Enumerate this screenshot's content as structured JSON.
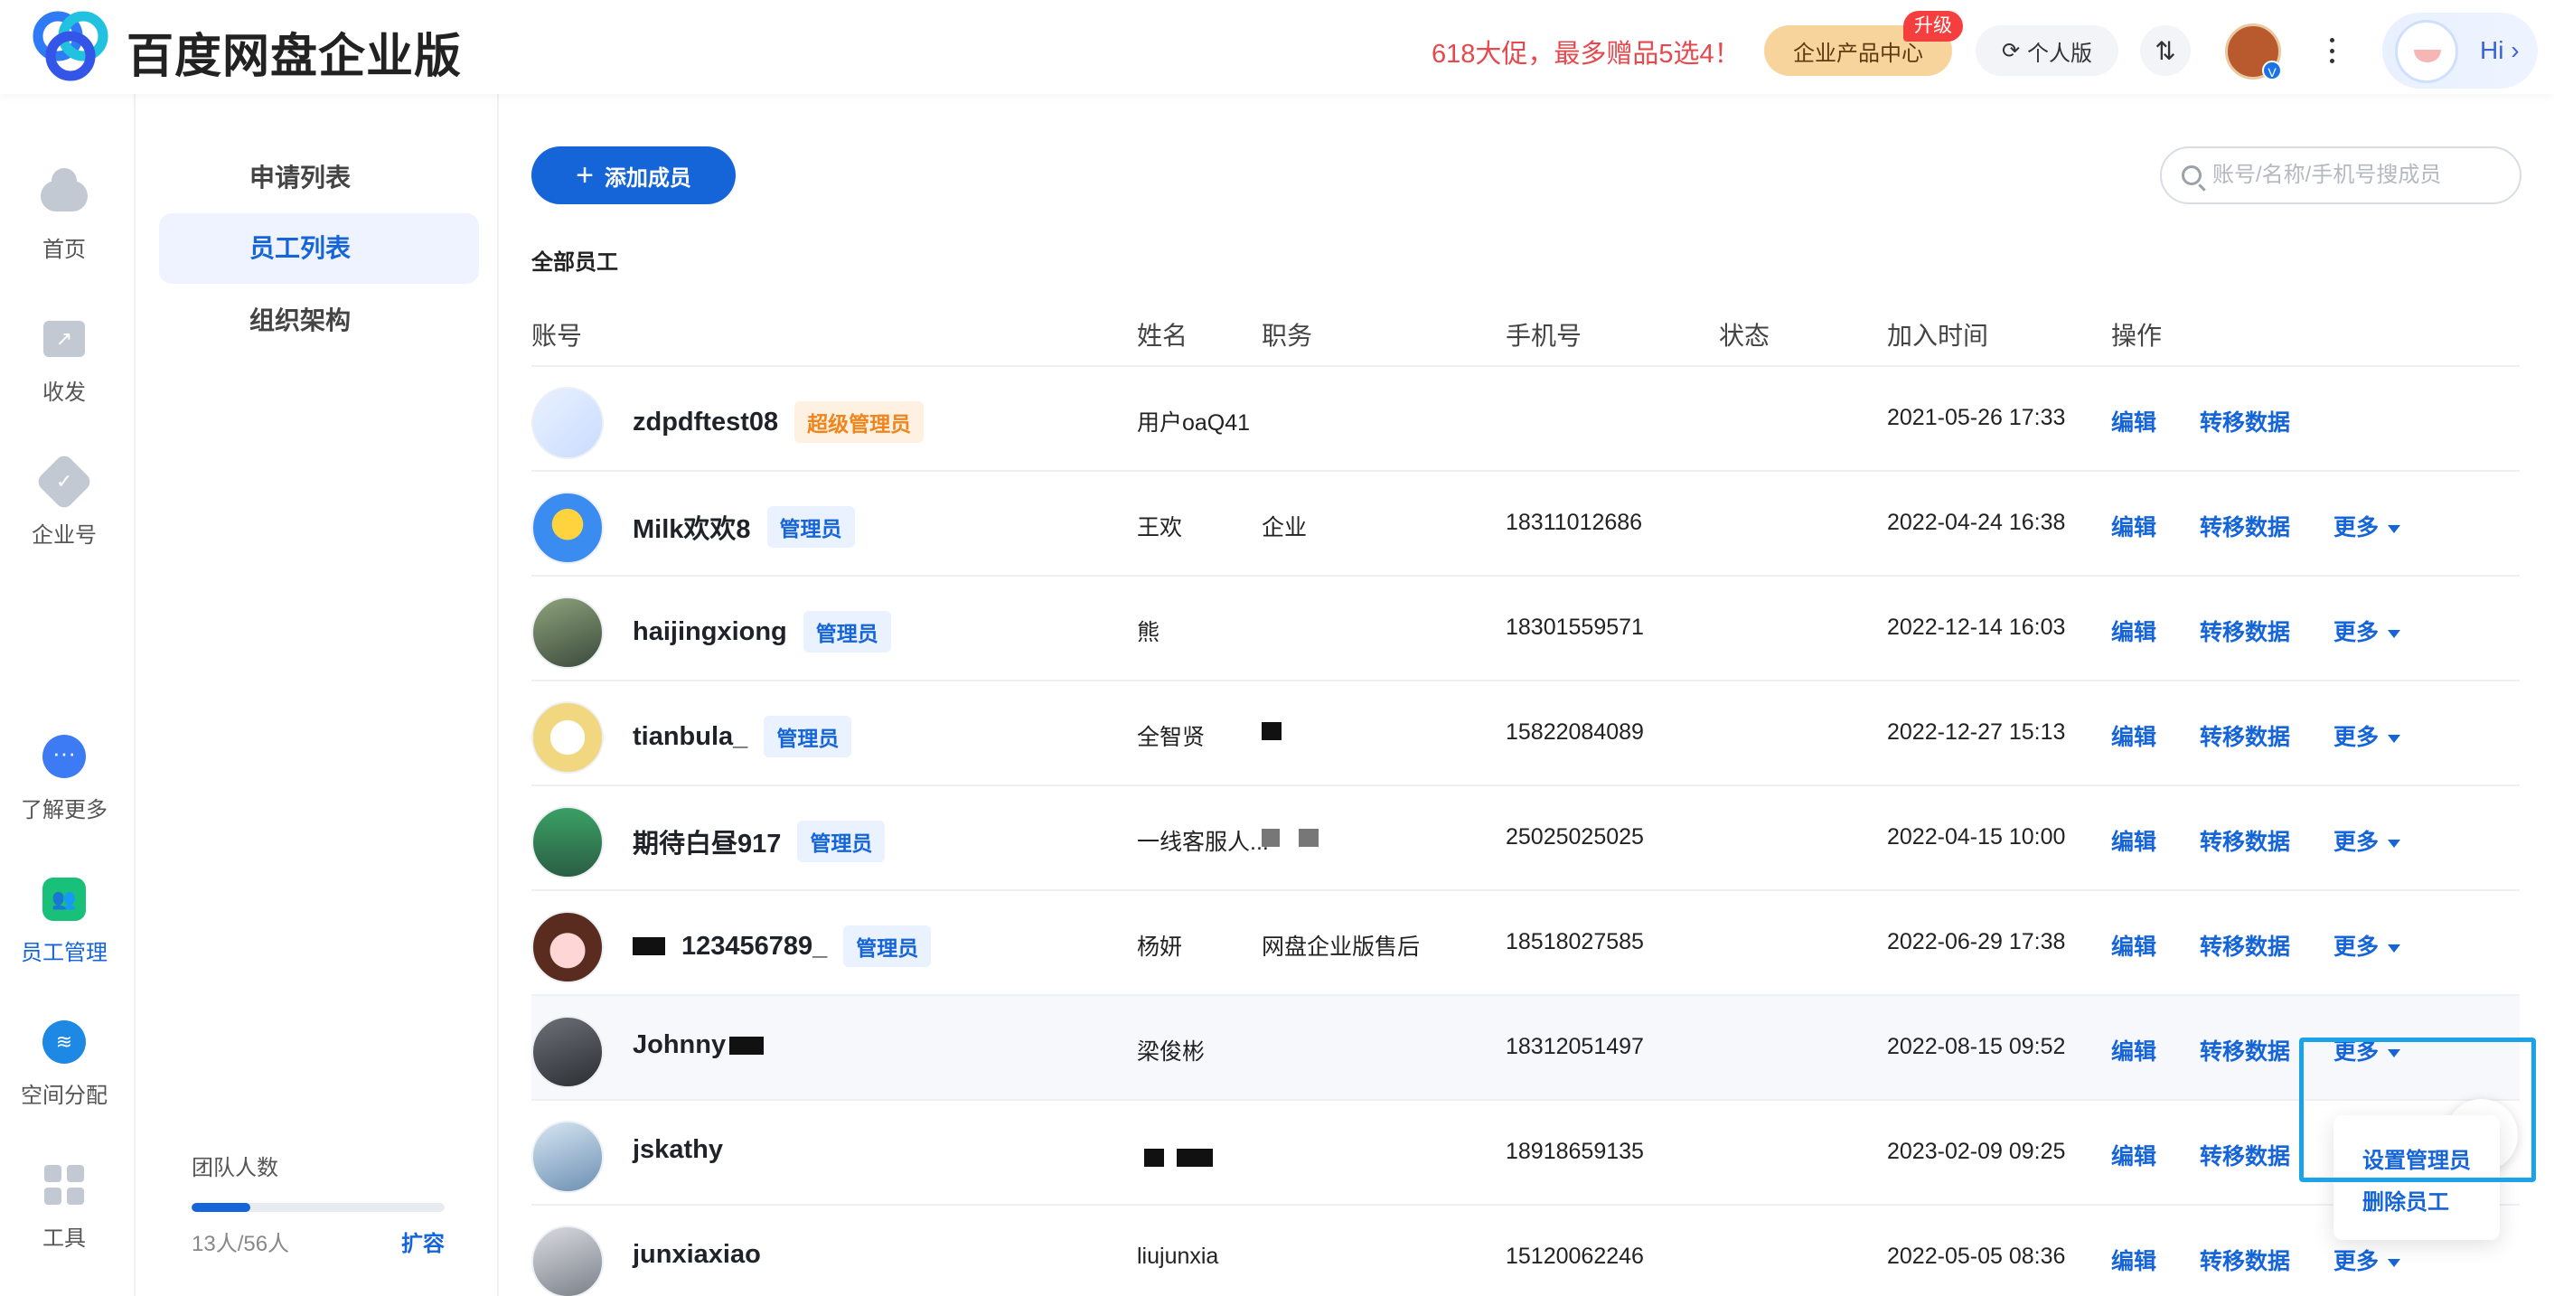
{
  "header": {
    "logo_text": "百度网盘企业版",
    "promo": "618大促，最多赠品5选4！",
    "enterprise_center": "企业产品中心",
    "upgrade_badge": "升级",
    "personal_edition": "个人版",
    "swap_icon": "⇅",
    "avatar_badge": "V",
    "hi": "Hi ›"
  },
  "rail": {
    "items": [
      {
        "label": "首页",
        "icon": "cloud-icon"
      },
      {
        "label": "收发",
        "icon": "transfer-icon"
      },
      {
        "label": "企业号",
        "icon": "badge-icon"
      },
      {
        "label": "了解更多",
        "icon": "more-dots-icon"
      },
      {
        "label": "员工管理",
        "icon": "team-icon",
        "active": true
      },
      {
        "label": "空间分配",
        "icon": "stack-icon"
      },
      {
        "label": "工具",
        "icon": "grid-icon"
      }
    ]
  },
  "subnav": {
    "items": [
      {
        "label": "申请列表"
      },
      {
        "label": "员工列表",
        "active": true
      },
      {
        "label": "组织架构"
      }
    ]
  },
  "team": {
    "title": "团队人数",
    "count": "13人/56人",
    "used_fraction": 0.232,
    "expand": "扩容"
  },
  "main": {
    "add_button": "添加成员",
    "search_placeholder": "账号/名称/手机号搜成员",
    "section_title": "全部员工",
    "columns": [
      "账号",
      "姓名",
      "职务",
      "手机号",
      "状态",
      "加入时间",
      "操作"
    ],
    "actions": {
      "edit": "编辑",
      "transfer": "转移数据",
      "more": "更多"
    },
    "rows": [
      {
        "account": "zdpdftest08",
        "role": "超级管理员",
        "role_type": "super",
        "name": "用户oaQ41",
        "title": "",
        "phone": "",
        "joined": "2021-05-26 17:33",
        "has_more": false
      },
      {
        "account": "Milk欢欢8",
        "role": "管理员",
        "role_type": "admin",
        "name": "王欢",
        "title": "企业",
        "phone": "18311012686",
        "joined": "2022-04-24 16:38",
        "has_more": true
      },
      {
        "account": "haijingxiong",
        "role": "管理员",
        "role_type": "admin",
        "name": "熊",
        "title": "",
        "phone": "18301559571",
        "joined": "2022-12-14 16:03",
        "has_more": true
      },
      {
        "account": "tianbula_",
        "role": "管理员",
        "role_type": "admin",
        "name": "全智贤",
        "title": "",
        "phone": "15822084089",
        "joined": "2022-12-27 15:13",
        "has_more": true
      },
      {
        "account": "期待白昼917",
        "role": "管理员",
        "role_type": "admin",
        "name": "一线客服人...",
        "title": "",
        "phone": "25025025025",
        "joined": "2022-04-15 10:00",
        "has_more": true
      },
      {
        "account": "123456789_",
        "role": "管理员",
        "role_type": "admin",
        "name": "杨妍",
        "title": "网盘企业版售后",
        "phone": "18518027585",
        "joined": "2022-06-29 17:38",
        "has_more": true
      },
      {
        "account": "Johnny",
        "role": "",
        "role_type": "",
        "name": "梁俊彬",
        "title": "",
        "phone": "18312051497",
        "joined": "2022-08-15 09:52",
        "has_more": true
      },
      {
        "account": "jskathy",
        "role": "",
        "role_type": "",
        "name": "",
        "title": "",
        "phone": "18918659135",
        "joined": "2023-02-09 09:25",
        "has_more": true
      },
      {
        "account": "junxiaxiao",
        "role": "",
        "role_type": "",
        "name": "liujunxia",
        "title": "",
        "phone": "15120062246",
        "joined": "2022-05-05 08:36",
        "has_more": true
      }
    ]
  },
  "dropdown": {
    "items": [
      "设置管理员",
      "删除员工"
    ]
  },
  "colors": {
    "primary": "#1565d8",
    "promo": "#e5484d",
    "gold": "#f6d49b",
    "super_role": "#f0851e"
  }
}
